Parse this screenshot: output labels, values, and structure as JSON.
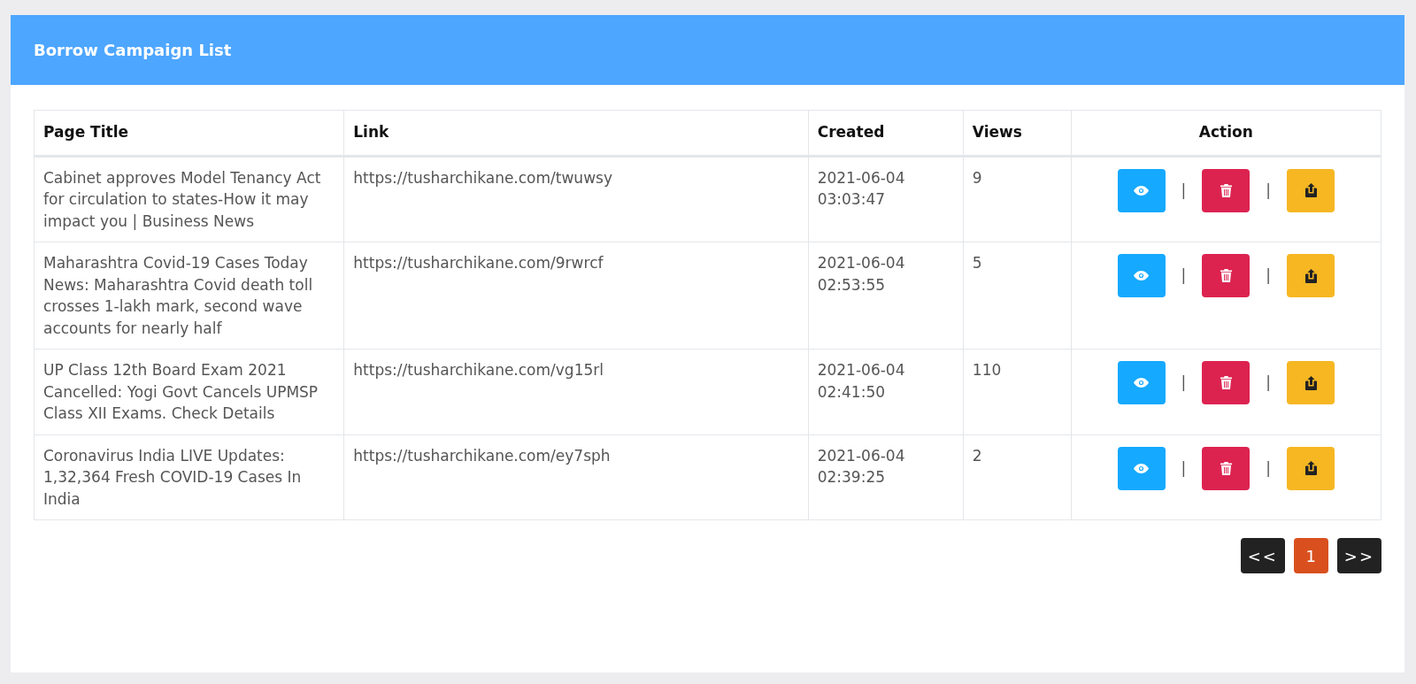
{
  "header": {
    "title": "Borrow Campaign List"
  },
  "table": {
    "columns": [
      "Page Title",
      "Link",
      "Created",
      "Views",
      "Action"
    ],
    "rows": [
      {
        "page_title": "Cabinet approves Model Tenancy Act for circulation to states-How it may impact you | Business News",
        "link": "https://tusharchikane.com/twuwsy",
        "created": "2021-06-04 03:03:47",
        "views": "9",
        "separators": [
          "|",
          "|"
        ]
      },
      {
        "page_title": "Maharashtra Covid-19 Cases Today News: Maharashtra Covid death toll crosses 1-lakh mark, second wave accounts for nearly half",
        "link": "https://tusharchikane.com/9rwrcf",
        "created": "2021-06-04 02:53:55",
        "views": "5",
        "separators": [
          "|",
          "|"
        ]
      },
      {
        "page_title": "UP Class 12th Board Exam 2021 Cancelled: Yogi Govt Cancels UPMSP Class XII Exams. Check Details",
        "link": "https://tusharchikane.com/vg15rl",
        "created": "2021-06-04 02:41:50",
        "views": "110",
        "separators": [
          "|",
          "|"
        ]
      },
      {
        "page_title": "Coronavirus India LIVE Updates: 1,32,364 Fresh COVID-19 Cases In India",
        "link": "https://tusharchikane.com/ey7sph",
        "created": "2021-06-04 02:39:25",
        "views": "2",
        "separators": [
          "|",
          "|"
        ]
      }
    ]
  },
  "pagination": {
    "prev": "<<",
    "pages": [
      {
        "label": "1",
        "selected": true
      }
    ],
    "next": ">>"
  }
}
